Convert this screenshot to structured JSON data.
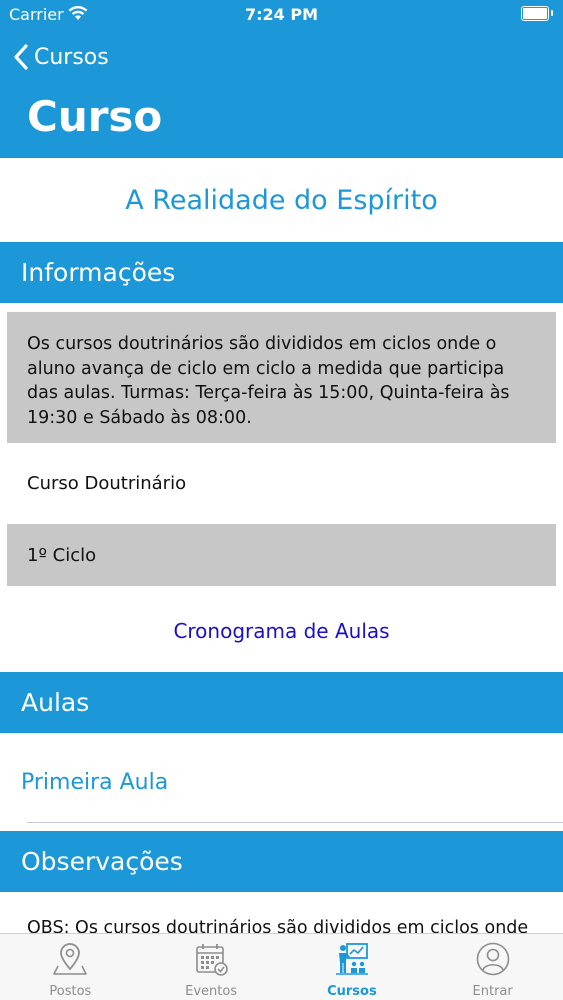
{
  "status_bar": {
    "carrier": "Carrier",
    "time": "7:24 PM"
  },
  "nav": {
    "back_label": "Cursos",
    "title": "Curso"
  },
  "course": {
    "name": "A Realidade do Espírito"
  },
  "informacoes": {
    "header": "Informações",
    "description": "Os cursos doutrinários são divididos em ciclos onde o aluno avança de ciclo em ciclo a medida que participa das aulas. Turmas: Terça-feira às 15:00, Quinta-feira às 19:30 e Sábado às 08:00.",
    "type": "Curso Doutrinário",
    "cycle": "1º Ciclo",
    "schedule_link": "Cronograma de Aulas"
  },
  "aulas": {
    "header": "Aulas",
    "items": [
      {
        "label": "Primeira Aula"
      }
    ]
  },
  "observacoes": {
    "header": "Observações",
    "text": "OBS: Os cursos doutrinários são divididos em ciclos onde"
  },
  "tabbar": {
    "items": [
      {
        "label": "Postos",
        "icon": "map-pin-icon"
      },
      {
        "label": "Eventos",
        "icon": "calendar-icon"
      },
      {
        "label": "Cursos",
        "icon": "teacher-board-icon"
      },
      {
        "label": "Entrar",
        "icon": "user-icon"
      }
    ],
    "active_index": 2
  },
  "colors": {
    "accent": "#1c98d8",
    "gray_row": "#c8c7c8",
    "link": "#1a0fd0",
    "inactive_tab": "#8e8e8e"
  }
}
